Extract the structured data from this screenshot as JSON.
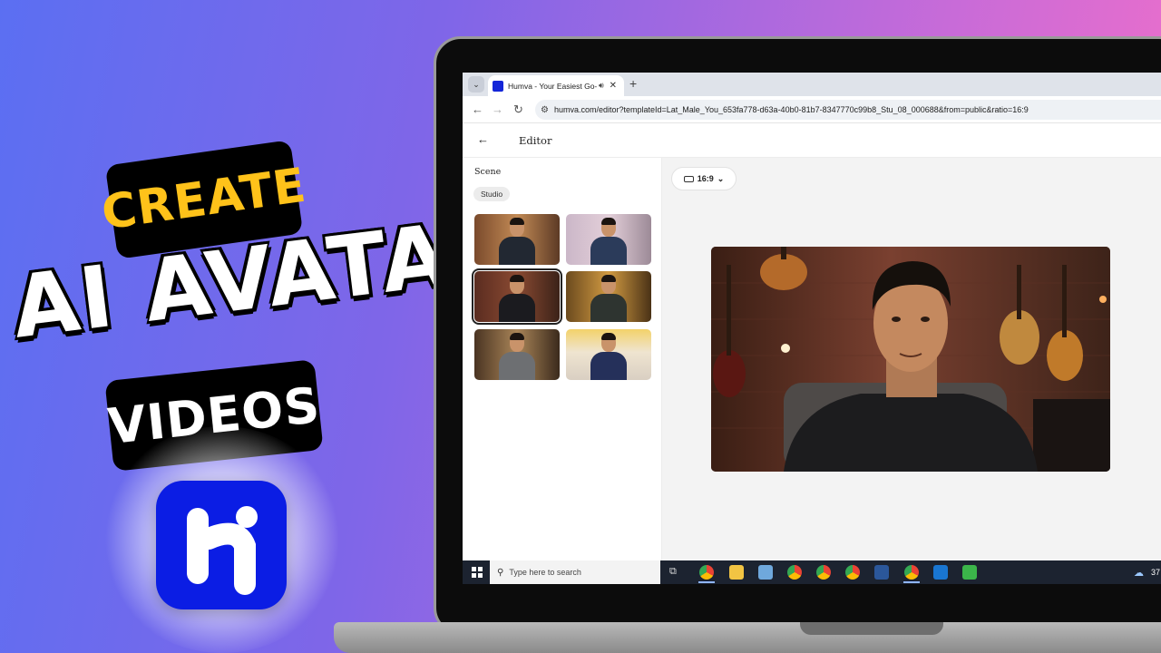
{
  "promo": {
    "line1": "CREATE",
    "line2": "AI AVATAR",
    "line3": "VIDEOS",
    "logo_icon": "humva-logo-icon",
    "colors": {
      "line1": "#ffc21a",
      "logo_bg": "#0b1de4"
    }
  },
  "browser": {
    "tab_title": "Humva - Your Easiest Go-To",
    "tab_icons": [
      "tab-list-icon",
      "audio-icon",
      "close-icon",
      "plus-icon"
    ],
    "url": "humva.com/editor?templateId=Lat_Male_You_653fa778-d63a-40b0-81b7-8347770c99b8_Stu_08_000688&from=public&ratio=16:9",
    "nav_icons": [
      "back-arrow-icon",
      "forward-arrow-icon",
      "reload-icon",
      "site-settings-icon"
    ]
  },
  "app": {
    "title": "Editor",
    "left_panel": {
      "heading": "Scene",
      "filter_chip": "Studio",
      "thumbnails": [
        {
          "name": "scene-thumb-1",
          "selected": false
        },
        {
          "name": "scene-thumb-2",
          "selected": false
        },
        {
          "name": "scene-thumb-3",
          "selected": true
        },
        {
          "name": "scene-thumb-4",
          "selected": false
        },
        {
          "name": "scene-thumb-5",
          "selected": false
        },
        {
          "name": "scene-thumb-6",
          "selected": false
        }
      ]
    },
    "workspace": {
      "ratio_label": "16:9"
    }
  },
  "taskbar": {
    "search_placeholder": "Type here to search",
    "tray_temp": "37",
    "apps": [
      "chrome-icon",
      "file-explorer-icon",
      "app-icon",
      "chrome-icon",
      "chrome-icon",
      "chrome-icon",
      "word-icon",
      "chrome-icon",
      "app-icon",
      "camtasia-icon"
    ]
  }
}
